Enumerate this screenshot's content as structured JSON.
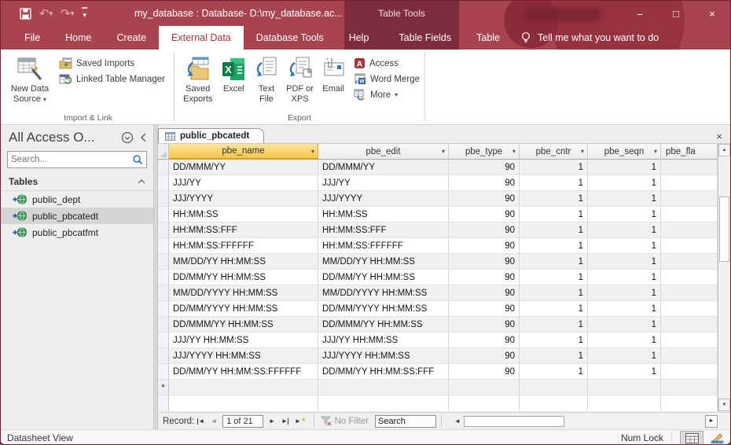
{
  "titlebar": {
    "title": "my_database : Database- D:\\my_database.ac...",
    "contextual_title": "Table Tools"
  },
  "tabs": {
    "items": [
      "File",
      "Home",
      "Create",
      "External Data",
      "Database Tools",
      "Help"
    ],
    "active": "External Data",
    "contextual_items": [
      "Table Fields",
      "Table"
    ],
    "tell_me": "Tell me what you want to do"
  },
  "ribbon": {
    "import_group": {
      "label": "Import & Link",
      "new_data_source": "New Data Source",
      "saved_imports": "Saved Imports",
      "linked_table_manager": "Linked Table Manager"
    },
    "export_group": {
      "label": "Export",
      "saved_exports": "Saved Exports",
      "excel": "Excel",
      "text_file": "Text File",
      "pdf_or_xps": "PDF or XPS",
      "email": "Email",
      "access": "Access",
      "word_merge": "Word Merge",
      "more": "More"
    }
  },
  "sidebar": {
    "title": "All Access O...",
    "search_placeholder": "Search...",
    "group_label": "Tables",
    "items": [
      {
        "label": "public_dept",
        "selected": false
      },
      {
        "label": "public_pbcatedt",
        "selected": true
      },
      {
        "label": "public_pbcatfmt",
        "selected": false
      }
    ]
  },
  "document": {
    "tab_label": "public_pbcatedt",
    "columns": [
      "pbe_name",
      "pbe_edit",
      "pbe_type",
      "pbe_cntr",
      "pbe_seqn",
      "pbe_fla"
    ],
    "rows": [
      [
        "DD/MMM/YY",
        "DD/MMM/YY",
        "90",
        "1",
        "1",
        ""
      ],
      [
        "JJJ/YY",
        "JJJ/YY",
        "90",
        "1",
        "1",
        ""
      ],
      [
        "JJJ/YYYY",
        "JJJ/YYYY",
        "90",
        "1",
        "1",
        ""
      ],
      [
        "HH:MM:SS",
        "HH:MM:SS",
        "90",
        "1",
        "1",
        ""
      ],
      [
        "HH:MM:SS:FFF",
        "HH:MM:SS:FFF",
        "90",
        "1",
        "1",
        ""
      ],
      [
        "HH:MM:SS:FFFFFF",
        "HH:MM:SS:FFFFFF",
        "90",
        "1",
        "1",
        ""
      ],
      [
        "MM/DD/YY HH:MM:SS",
        "MM/DD/YY HH:MM:SS",
        "90",
        "1",
        "1",
        ""
      ],
      [
        "DD/MM/YY HH:MM:SS",
        "DD/MM/YY HH:MM:SS",
        "90",
        "1",
        "1",
        ""
      ],
      [
        "MM/DD/YYYY HH:MM:SS",
        "MM/DD/YYYY HH:MM:SS",
        "90",
        "1",
        "1",
        ""
      ],
      [
        "DD/MM/YYYY HH:MM:SS",
        "DD/MM/YYYY HH:MM:SS",
        "90",
        "1",
        "1",
        ""
      ],
      [
        "DD/MMM/YY HH:MM:SS",
        "DD/MMM/YY HH:MM:SS",
        "90",
        "1",
        "1",
        ""
      ],
      [
        "JJJ/YY HH:MM:SS",
        "JJJ/YY HH:MM:SS",
        "90",
        "1",
        "1",
        ""
      ],
      [
        "JJJ/YYYY HH:MM:SS",
        "JJJ/YYYY HH:MM:SS",
        "90",
        "1",
        "1",
        ""
      ],
      [
        "DD/MM/YY HH:MM:SS:FFFFFF",
        "DD/MM/YY HH:MM:SS:FFF",
        "90",
        "1",
        "1",
        ""
      ]
    ],
    "new_record_marker": "*"
  },
  "record_nav": {
    "label": "Record:",
    "position": "1 of 21",
    "filter_label": "No Filter",
    "search_placeholder": "Search"
  },
  "status": {
    "view": "Datasheet View",
    "num_lock": "Num Lock"
  },
  "icons": {
    "caret_down": "▾",
    "chevron_up": "⌃",
    "collapse": "‹",
    "window_minimize": "–",
    "window_maximize": "□",
    "window_close": "×",
    "doc_close": "×",
    "nav_first": "◄",
    "nav_prev": "◄",
    "nav_next": "►",
    "nav_last": "►",
    "new_record_star": "*",
    "scroll_up": "▲",
    "scroll_down": "▼",
    "scroll_right": "►",
    "scroll_left": "◄",
    "undo": "↶",
    "redo": "↷"
  },
  "colors": {
    "accent_red": "#A8444F",
    "contextual_red": "#7E2C3C",
    "selected_header_gold": "#F5C54E"
  }
}
